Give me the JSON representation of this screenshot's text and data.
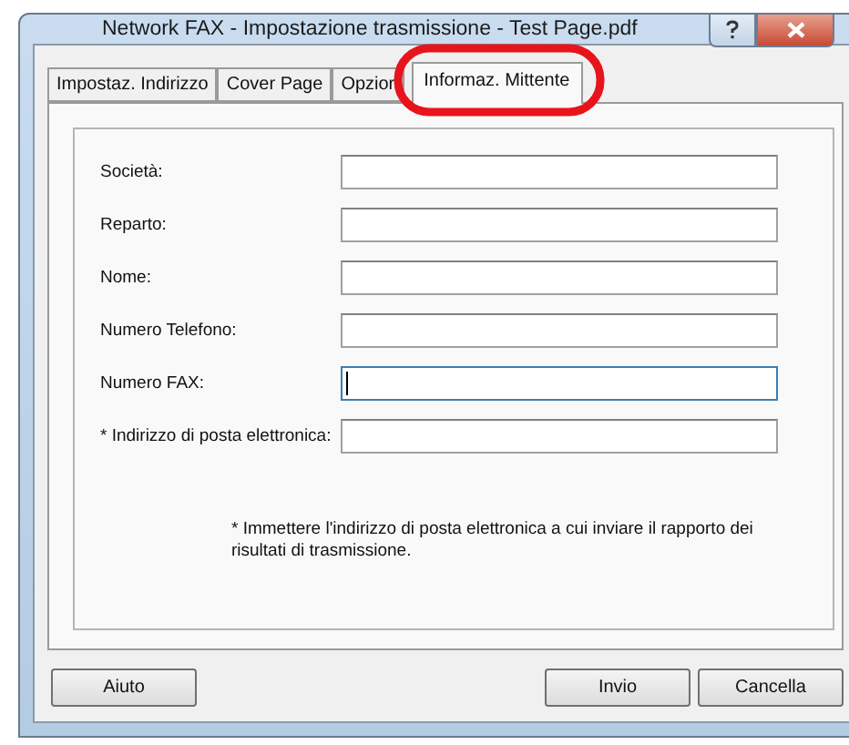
{
  "window": {
    "title": "Network FAX - Impostazione trasmissione - Test Page.pdf"
  },
  "tabs": [
    {
      "label": "Impostaz. Indirizzo",
      "selected": false,
      "circled": false
    },
    {
      "label": "Cover Page",
      "selected": false,
      "circled": false
    },
    {
      "label": "Opzior",
      "selected": false,
      "circled": false
    },
    {
      "label": "Informaz. Mittente",
      "selected": true,
      "circled": true
    }
  ],
  "fields": [
    {
      "label": "Società:",
      "focused": false
    },
    {
      "label": "Reparto:",
      "focused": false
    },
    {
      "label": "Nome:",
      "focused": false
    },
    {
      "label": "Numero Telefono:",
      "focused": false
    },
    {
      "label": "Numero FAX:",
      "focused": true
    },
    {
      "label": "* Indirizzo di posta elettronica:",
      "focused": false
    }
  ],
  "note": "* Immettere l'indirizzo di posta elettronica a cui inviare il rapporto dei risultati di trasmissione.",
  "buttons": {
    "left": [
      "Aiuto"
    ],
    "right": [
      "Invio",
      "Cancella"
    ]
  }
}
